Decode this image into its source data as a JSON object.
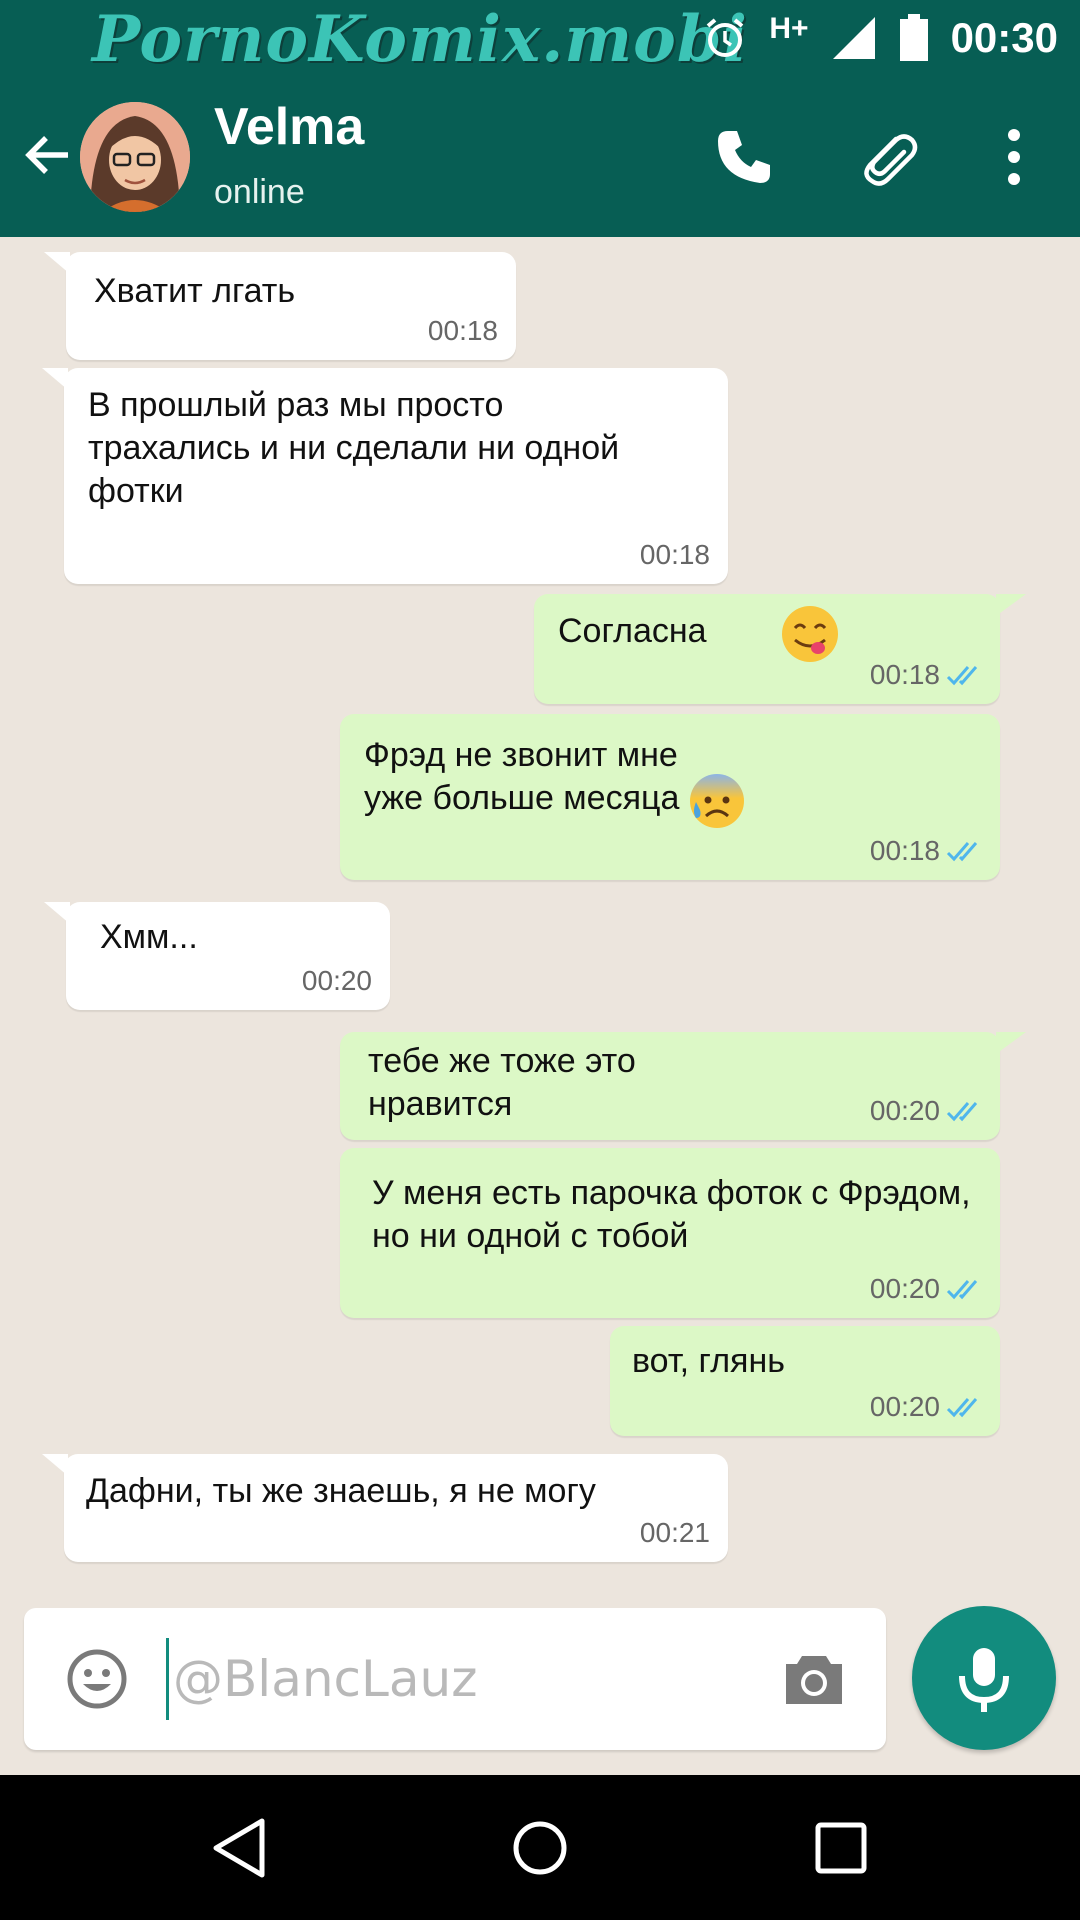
{
  "status_bar": {
    "watermark": "PornoKomix.mobi",
    "network": "H+",
    "time": "00:30",
    "icons": [
      "alarm-icon",
      "signal-icon",
      "battery-icon"
    ]
  },
  "header": {
    "contact_name": "Velma",
    "contact_status": "online",
    "icons": [
      "back-arrow-icon",
      "avatar",
      "phone-icon",
      "paperclip-icon",
      "more-vert-icon"
    ]
  },
  "messages": [
    {
      "direction": "in",
      "text": "Хватит лгать",
      "time": "00:18"
    },
    {
      "direction": "in",
      "text": "В прошлый раз мы просто\nтрахались и ни сделали ни одной\nфотки",
      "time": "00:18"
    },
    {
      "direction": "out",
      "text": "Согласна",
      "emoji": "yum-emoji",
      "time": "00:18",
      "ticks": "read"
    },
    {
      "direction": "out",
      "text": "Фрэд не звонит мне\nуже больше месяца",
      "emoji": "anxious-sweat-emoji",
      "time": "00:18",
      "ticks": "read"
    },
    {
      "direction": "in",
      "text": "Хмм...",
      "time": "00:20"
    },
    {
      "direction": "out",
      "text": "тебе же тоже это\nнравится",
      "time": "00:20",
      "ticks": "read"
    },
    {
      "direction": "out",
      "text": "У меня есть парочка фоток с Фрэдом,\nно ни одной с тобой",
      "time": "00:20",
      "ticks": "read"
    },
    {
      "direction": "out",
      "text": "вот, глянь",
      "time": "00:20",
      "ticks": "read"
    },
    {
      "direction": "in",
      "text": "Дафни, ты же знаешь, я не могу",
      "time": "00:21"
    }
  ],
  "composer": {
    "placeholder": "@BlancLauz",
    "icons": [
      "smiley-icon",
      "camera-icon",
      "mic-icon"
    ]
  },
  "nav_bar": {
    "icons": [
      "nav-back-icon",
      "nav-home-icon",
      "nav-recents-icon"
    ]
  },
  "colors": {
    "header": "#075e54",
    "chat_background": "#ece5dd",
    "incoming_bubble": "#ffffff",
    "outgoing_bubble": "#dcf8c6",
    "accent": "#128c7e",
    "read_ticks": "#4fb6ec"
  }
}
